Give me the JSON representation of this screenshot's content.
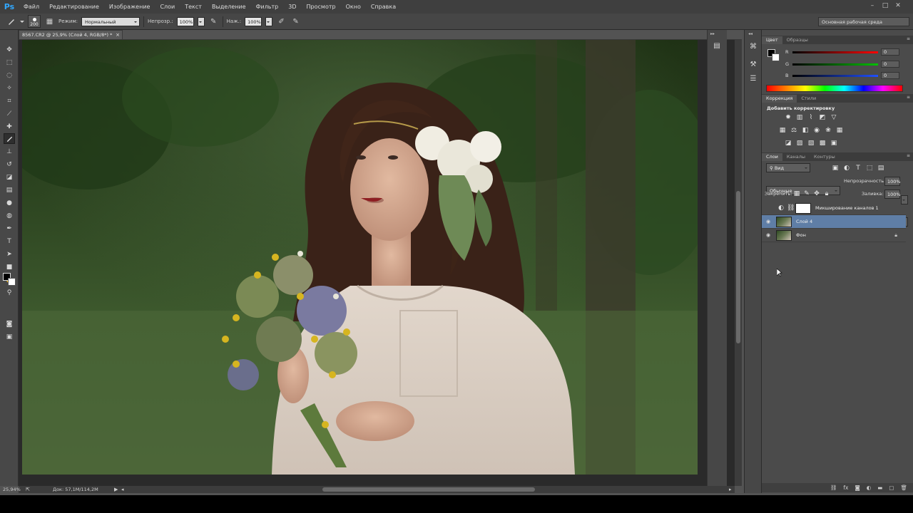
{
  "app": {
    "logo": "Ps"
  },
  "menu": [
    "Файл",
    "Редактирование",
    "Изображение",
    "Слои",
    "Текст",
    "Выделение",
    "Фильтр",
    "3D",
    "Просмотр",
    "Окно",
    "Справка"
  ],
  "window_controls": [
    "–",
    "□",
    "✕"
  ],
  "options_bar": {
    "brush_size": "200",
    "mode_label": "Режим:",
    "mode_value": "Нормальный",
    "opacity_label": "Непрозр.:",
    "opacity_value": "100%",
    "pressure_label": "Наж.:",
    "pressure_value": "100%",
    "workspace": "Основная рабочая среда"
  },
  "document_tab": {
    "title": "8567.CR2 @ 25,9% (Слой 4, RGB/8*) *",
    "close": "×"
  },
  "tools": [
    "move-tool",
    "marquee-tool",
    "lasso-tool",
    "quick-select-tool",
    "crop-tool",
    "eyedropper-tool",
    "healing-tool",
    "brush-tool",
    "stamp-tool",
    "history-brush-tool",
    "eraser-tool",
    "gradient-tool",
    "blur-tool",
    "dodge-tool",
    "pen-tool",
    "type-tool",
    "path-select-tool",
    "shape-tool",
    "hand-tool",
    "zoom-tool"
  ],
  "status": {
    "zoom": "25,94%",
    "doc": "Док: 57,1M/114,2M"
  },
  "color_panel": {
    "tabs": [
      "Цвет",
      "Образцы"
    ],
    "channels": [
      {
        "label": "R",
        "value": "0",
        "color": "#e03030"
      },
      {
        "label": "G",
        "value": "0",
        "color": "#30b030"
      },
      {
        "label": "B",
        "value": "0",
        "color": "#3060e0"
      }
    ]
  },
  "adjustments_panel": {
    "tabs": [
      "Коррекция",
      "Стили"
    ],
    "title": "Добавить корректировку"
  },
  "layers_panel": {
    "tabs": [
      "Слои",
      "Каналы",
      "Контуры"
    ],
    "filter": "Вид",
    "blend_mode": "Обычные",
    "opacity_label": "Непрозрачность:",
    "opacity_value": "100%",
    "lock_label": "Закрепить:",
    "fill_label": "Заливка:",
    "fill_value": "100%",
    "layers": [
      {
        "name": "Микширование каналов 1",
        "visible": false,
        "selected": false
      },
      {
        "name": "Слой 4",
        "visible": true,
        "selected": true
      },
      {
        "name": "Фон",
        "visible": true,
        "selected": false,
        "locked": true
      }
    ]
  },
  "colors": {
    "accent": "#31a8ff",
    "selection": "#5f7ea6"
  }
}
